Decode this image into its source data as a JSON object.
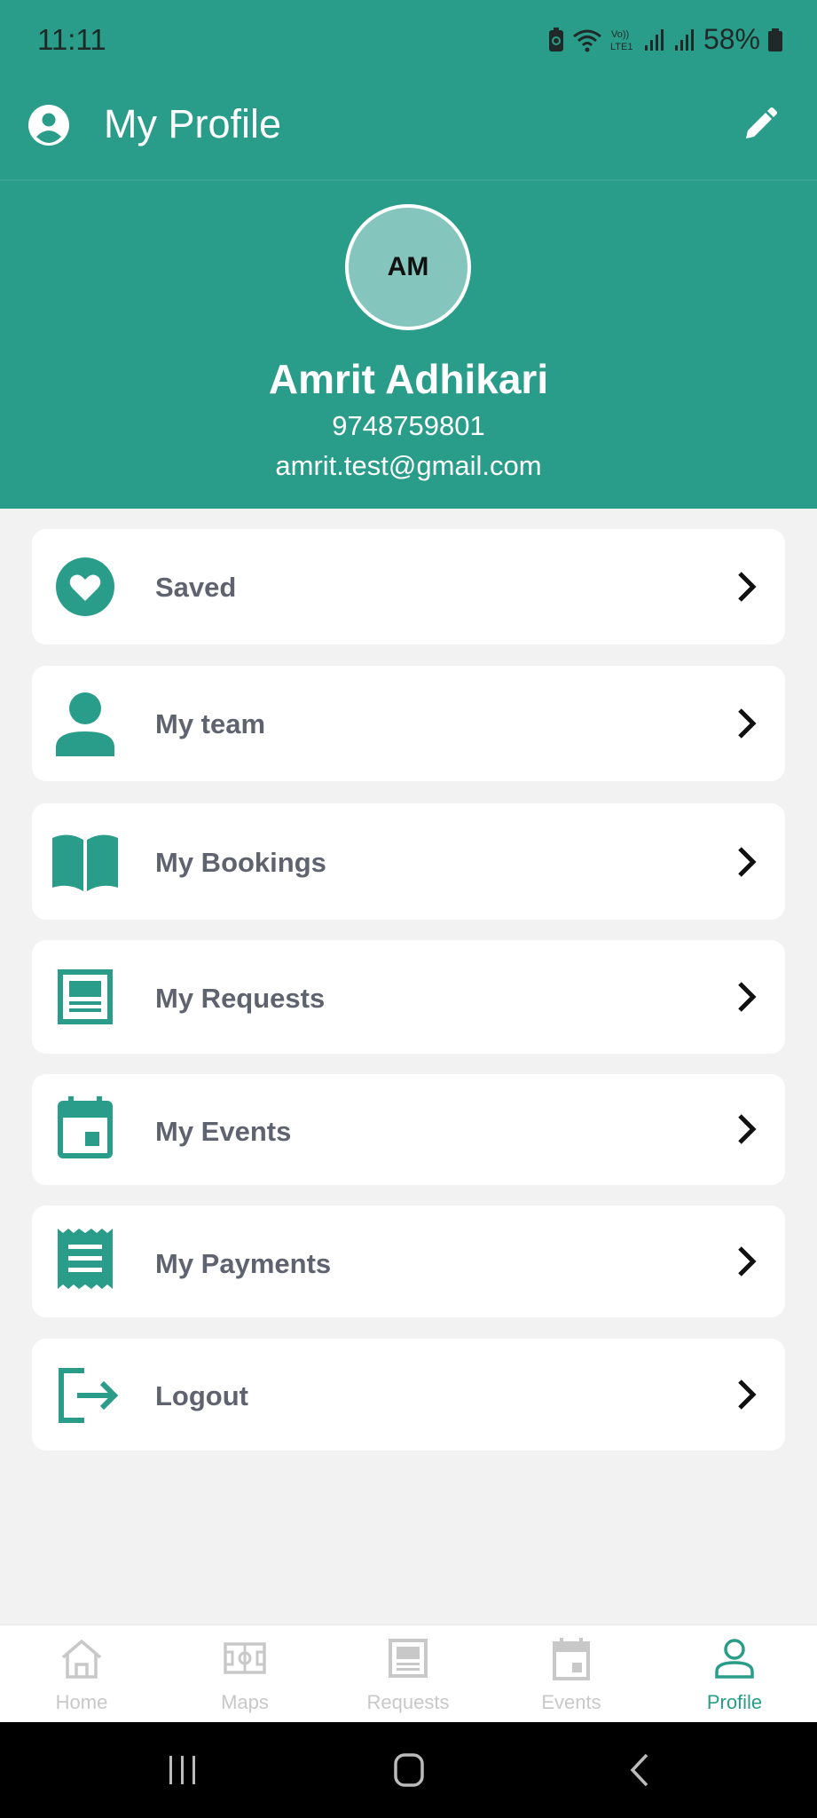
{
  "status_bar": {
    "time": "11:11",
    "battery": "58%"
  },
  "app_bar": {
    "title": "My Profile"
  },
  "profile": {
    "initials": "AM",
    "name": "Amrit Adhikari",
    "phone": "9748759801",
    "email": "amrit.test@gmail.com"
  },
  "menu": [
    {
      "label": "Saved",
      "icon": "heart-icon"
    },
    {
      "label": "My team",
      "icon": "person-icon"
    },
    {
      "label": "My Bookings",
      "icon": "book-icon"
    },
    {
      "label": "My Requests",
      "icon": "document-icon"
    },
    {
      "label": "My Events",
      "icon": "calendar-icon"
    },
    {
      "label": "My Payments",
      "icon": "receipt-icon"
    },
    {
      "label": "Logout",
      "icon": "logout-icon"
    }
  ],
  "bottom_nav": [
    {
      "label": "Home",
      "icon": "home-icon"
    },
    {
      "label": "Maps",
      "icon": "map-icon"
    },
    {
      "label": "Requests",
      "icon": "document-icon"
    },
    {
      "label": "Events",
      "icon": "calendar-icon"
    },
    {
      "label": "Profile",
      "icon": "profile-icon",
      "active": true
    }
  ],
  "colors": {
    "primary": "#2a9d8a",
    "avatar_bg": "#84c5bd",
    "background": "#f2f2f2",
    "menu_text": "#5f6370"
  }
}
